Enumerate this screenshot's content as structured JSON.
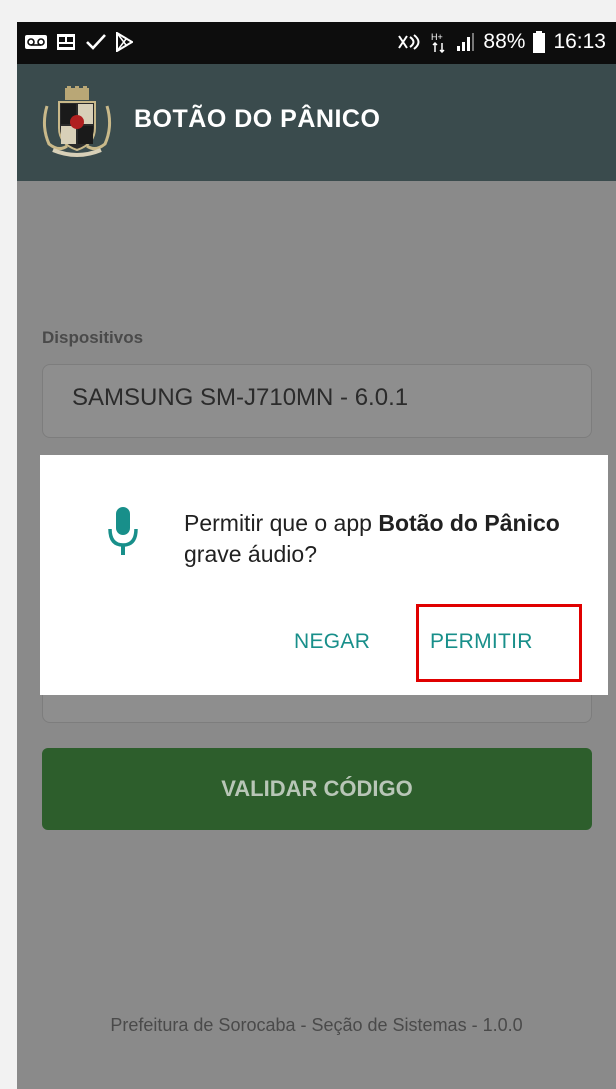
{
  "status_bar": {
    "left_icons": [
      "voicemail-icon",
      "app-crest-icon",
      "check-icon",
      "play-store-icon"
    ],
    "right_icons": [
      "nfc-icon",
      "data-signal-icon",
      "signal-bars-icon",
      "battery-icon"
    ],
    "battery_percent": "88%",
    "time": "16:13"
  },
  "app_bar": {
    "title": "BOTÃO DO PÂNICO",
    "color": "#3a4b4d"
  },
  "form": {
    "devices_label": "Dispositivos",
    "device_value": "SAMSUNG SM-J710MN - 6.0.1",
    "validate_button": "VALIDAR CÓDIGO"
  },
  "dialog": {
    "text_prefix": "Permitir que o app ",
    "app_name_bold": "Botão do Pânico",
    "text_suffix": " grave áudio?",
    "deny_button": "NEGAR",
    "allow_button": "PERMITIR",
    "accent_color": "#188f8a"
  },
  "footer": {
    "text": "Prefeitura de Sorocaba - Seção de Sistemas - 1.0.0"
  },
  "annotation": {
    "highlight_color": "#e00000"
  }
}
